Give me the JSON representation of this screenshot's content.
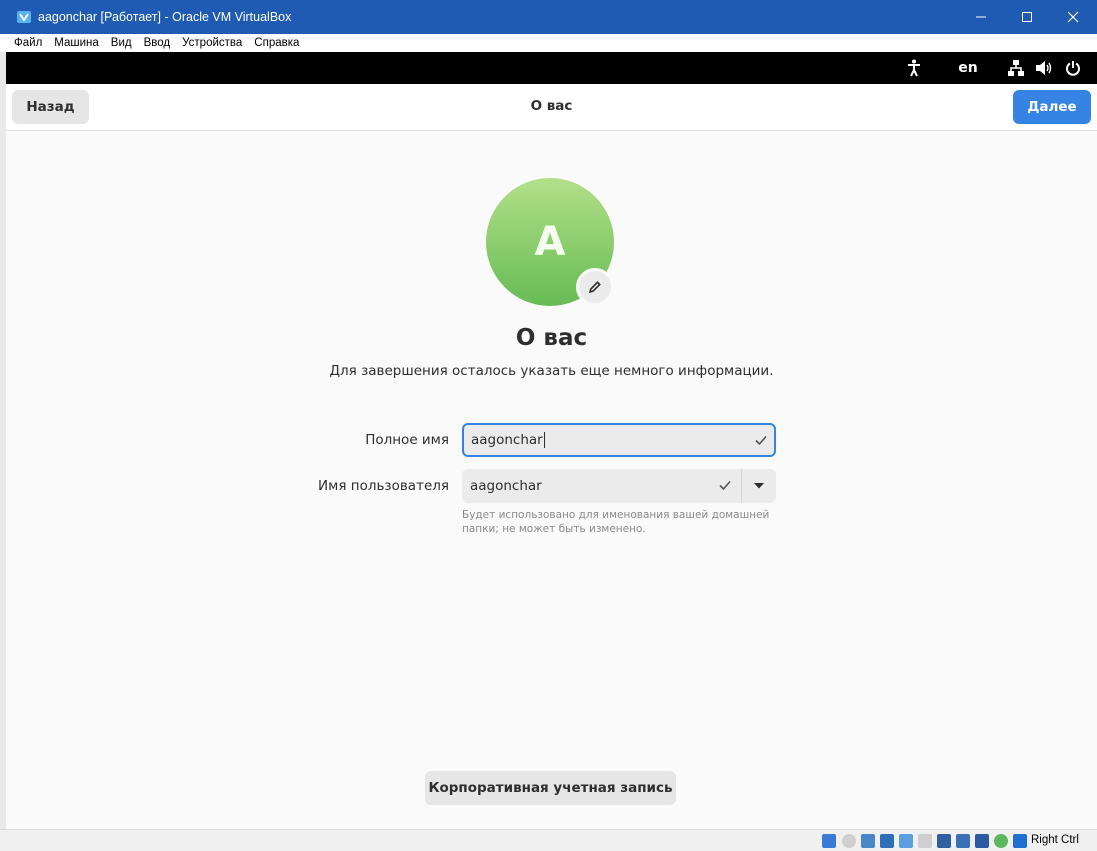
{
  "window": {
    "title": "aagonchar [Работает] - Oracle VM VirtualBox",
    "controls": {
      "minimize": "—",
      "maximize": "☐",
      "close": "✕"
    }
  },
  "menu": {
    "items": [
      "Файл",
      "Машина",
      "Вид",
      "Ввод",
      "Устройства",
      "Справка"
    ]
  },
  "top_bar": {
    "language": "en",
    "icons": [
      "accessibility-icon",
      "network-icon",
      "volume-icon",
      "power-icon"
    ]
  },
  "header": {
    "back_label": "Назад",
    "title": "О вас",
    "next_label": "Далее"
  },
  "avatar": {
    "initial": "A"
  },
  "main": {
    "title": "О вас",
    "subtitle": "Для завершения осталось указать еще немного информации."
  },
  "form": {
    "full_name_label": "Полное имя",
    "full_name_value": "aagonchar",
    "username_label": "Имя пользователя",
    "username_value": "aagonchar",
    "username_hint": "Будет использовано для именования вашей домашней папки; не может быть изменено."
  },
  "enterprise_button": "Корпоративная учетная запись",
  "statusbar": {
    "host_key": "Right Ctrl"
  },
  "colors": {
    "accent": "#3584e4",
    "titlebar": "#1f5bb3",
    "avatar_top": "#b3e08a",
    "avatar_bottom": "#66bb55"
  }
}
